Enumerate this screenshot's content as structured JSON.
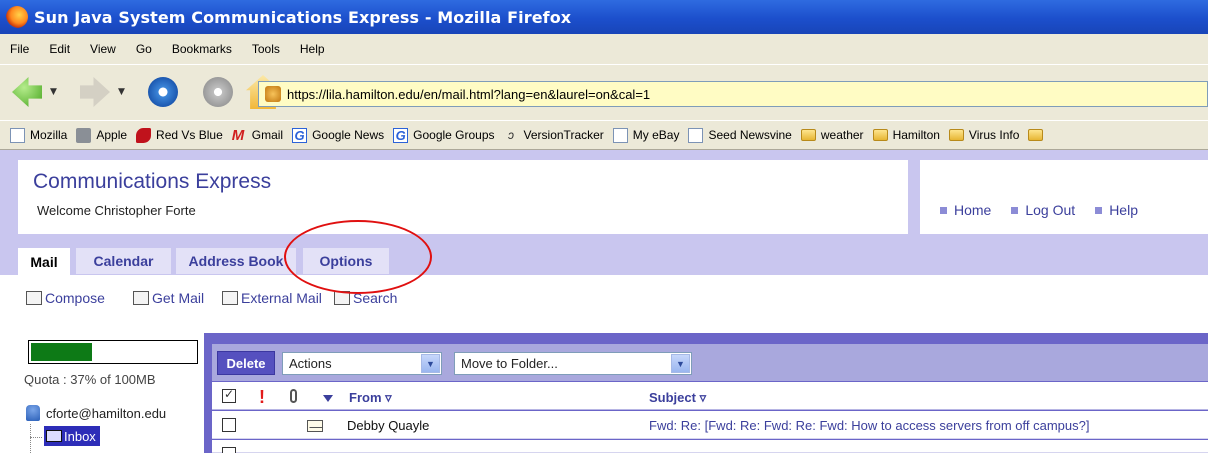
{
  "window": {
    "title": "Sun Java System Communications Express - Mozilla Firefox"
  },
  "menubar": [
    "File",
    "Edit",
    "View",
    "Go",
    "Bookmarks",
    "Tools",
    "Help"
  ],
  "address": {
    "url": "https://lila.hamilton.edu/en/mail.html?lang=en&laurel=on&cal=1"
  },
  "bookmarks": [
    {
      "label": "Mozilla",
      "icon": "page-icon"
    },
    {
      "label": "Apple",
      "icon": "apple-icon"
    },
    {
      "label": "Red Vs Blue",
      "icon": "redvsblue-icon"
    },
    {
      "label": "Gmail",
      "icon": "gmail-icon"
    },
    {
      "label": "Google News",
      "icon": "google-icon"
    },
    {
      "label": "Google Groups",
      "icon": "google-icon"
    },
    {
      "label": "VersionTracker",
      "icon": "versiontracker-icon"
    },
    {
      "label": "My eBay",
      "icon": "page-icon"
    },
    {
      "label": "Seed Newsvine",
      "icon": "page-icon"
    },
    {
      "label": "weather",
      "icon": "folder-icon"
    },
    {
      "label": "Hamilton",
      "icon": "folder-icon"
    },
    {
      "label": "Virus Info",
      "icon": "folder-icon"
    }
  ],
  "header": {
    "title": "Communications Express",
    "welcome": "Welcome Christopher Forte",
    "links": [
      "Home",
      "Log Out",
      "Help"
    ]
  },
  "tabs": [
    "Mail",
    "Calendar",
    "Address Book",
    "Options"
  ],
  "mail_toolbar": [
    "Compose",
    "Get Mail",
    "External Mail",
    "Search"
  ],
  "quota": {
    "label": "Quota : 37% of 100MB",
    "fraction": 0.37
  },
  "folders": {
    "account": "cforte@hamilton.edu",
    "inbox": "Inbox"
  },
  "actions": {
    "delete": "Delete",
    "actions_select": "Actions",
    "move_select": "Move to Folder..."
  },
  "columns": {
    "from": "From",
    "subject": "Subject"
  },
  "messages": [
    {
      "from": "Debby Quayle",
      "subject": "Fwd: Re: [Fwd: Re: Fwd: Re: Fwd: How to access servers from  off campus?]"
    }
  ],
  "colors": {
    "accent": "#3b3f9c",
    "page_bg": "#c9c6ef",
    "annotation": "#e01010"
  }
}
